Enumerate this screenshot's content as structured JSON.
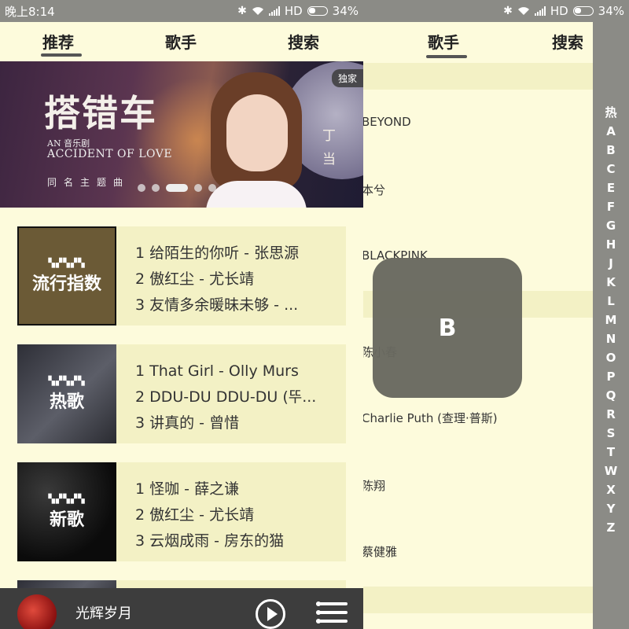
{
  "left": {
    "status": {
      "time": "晚上8:14",
      "network": "HD",
      "battery": "34%"
    },
    "tabs": [
      "推荐",
      "歌手",
      "搜索"
    ],
    "banner": {
      "title": "搭错车",
      "sub1": "AN 音乐剧",
      "sub2": "ACCIDENT OF LOVE",
      "sub3": "同名主题曲",
      "side": "丁当",
      "badge": "独家",
      "dot_count": 5,
      "active_dot": 2
    },
    "charts": [
      {
        "cover_label": "流行指数",
        "tracks": [
          "1 给陌生的你听 - 张思源",
          "2 傲红尘 - 尤长靖",
          "3 友情多余暖昧未够 - ..."
        ]
      },
      {
        "cover_label": "热歌",
        "tracks": [
          "1 That Girl - Olly Murs",
          "2 DDU-DU DDU-DU (뚜...",
          "3 讲真的 - 曾惜"
        ]
      },
      {
        "cover_label": "新歌",
        "tracks": [
          "1 怪咖 - 薛之谦",
          "2 傲红尘 - 尤长靖",
          "3 云烟成雨 - 房东的猫"
        ]
      }
    ],
    "player": {
      "title": "光辉岁月"
    }
  },
  "right": {
    "status": {
      "network": "HD",
      "battery": "34%"
    },
    "tabs": [
      "歌手",
      "搜索"
    ],
    "singers": [
      "BEYOND",
      "本兮",
      "BLACKPINK",
      "陈小春",
      "Charlie Puth (查理·普斯)",
      "陈翔",
      "蔡健雅"
    ],
    "index_letters": [
      "热",
      "A",
      "B",
      "C",
      "E",
      "F",
      "G",
      "H",
      "J",
      "K",
      "L",
      "M",
      "N",
      "O",
      "P",
      "Q",
      "R",
      "S",
      "T",
      "W",
      "X",
      "Y",
      "Z"
    ],
    "toast_letter": "B"
  },
  "colors": {
    "background": "#fdfbdc",
    "card": "#f3f1c5",
    "bar": "#8b8b86",
    "player": "#3d3d3d"
  }
}
